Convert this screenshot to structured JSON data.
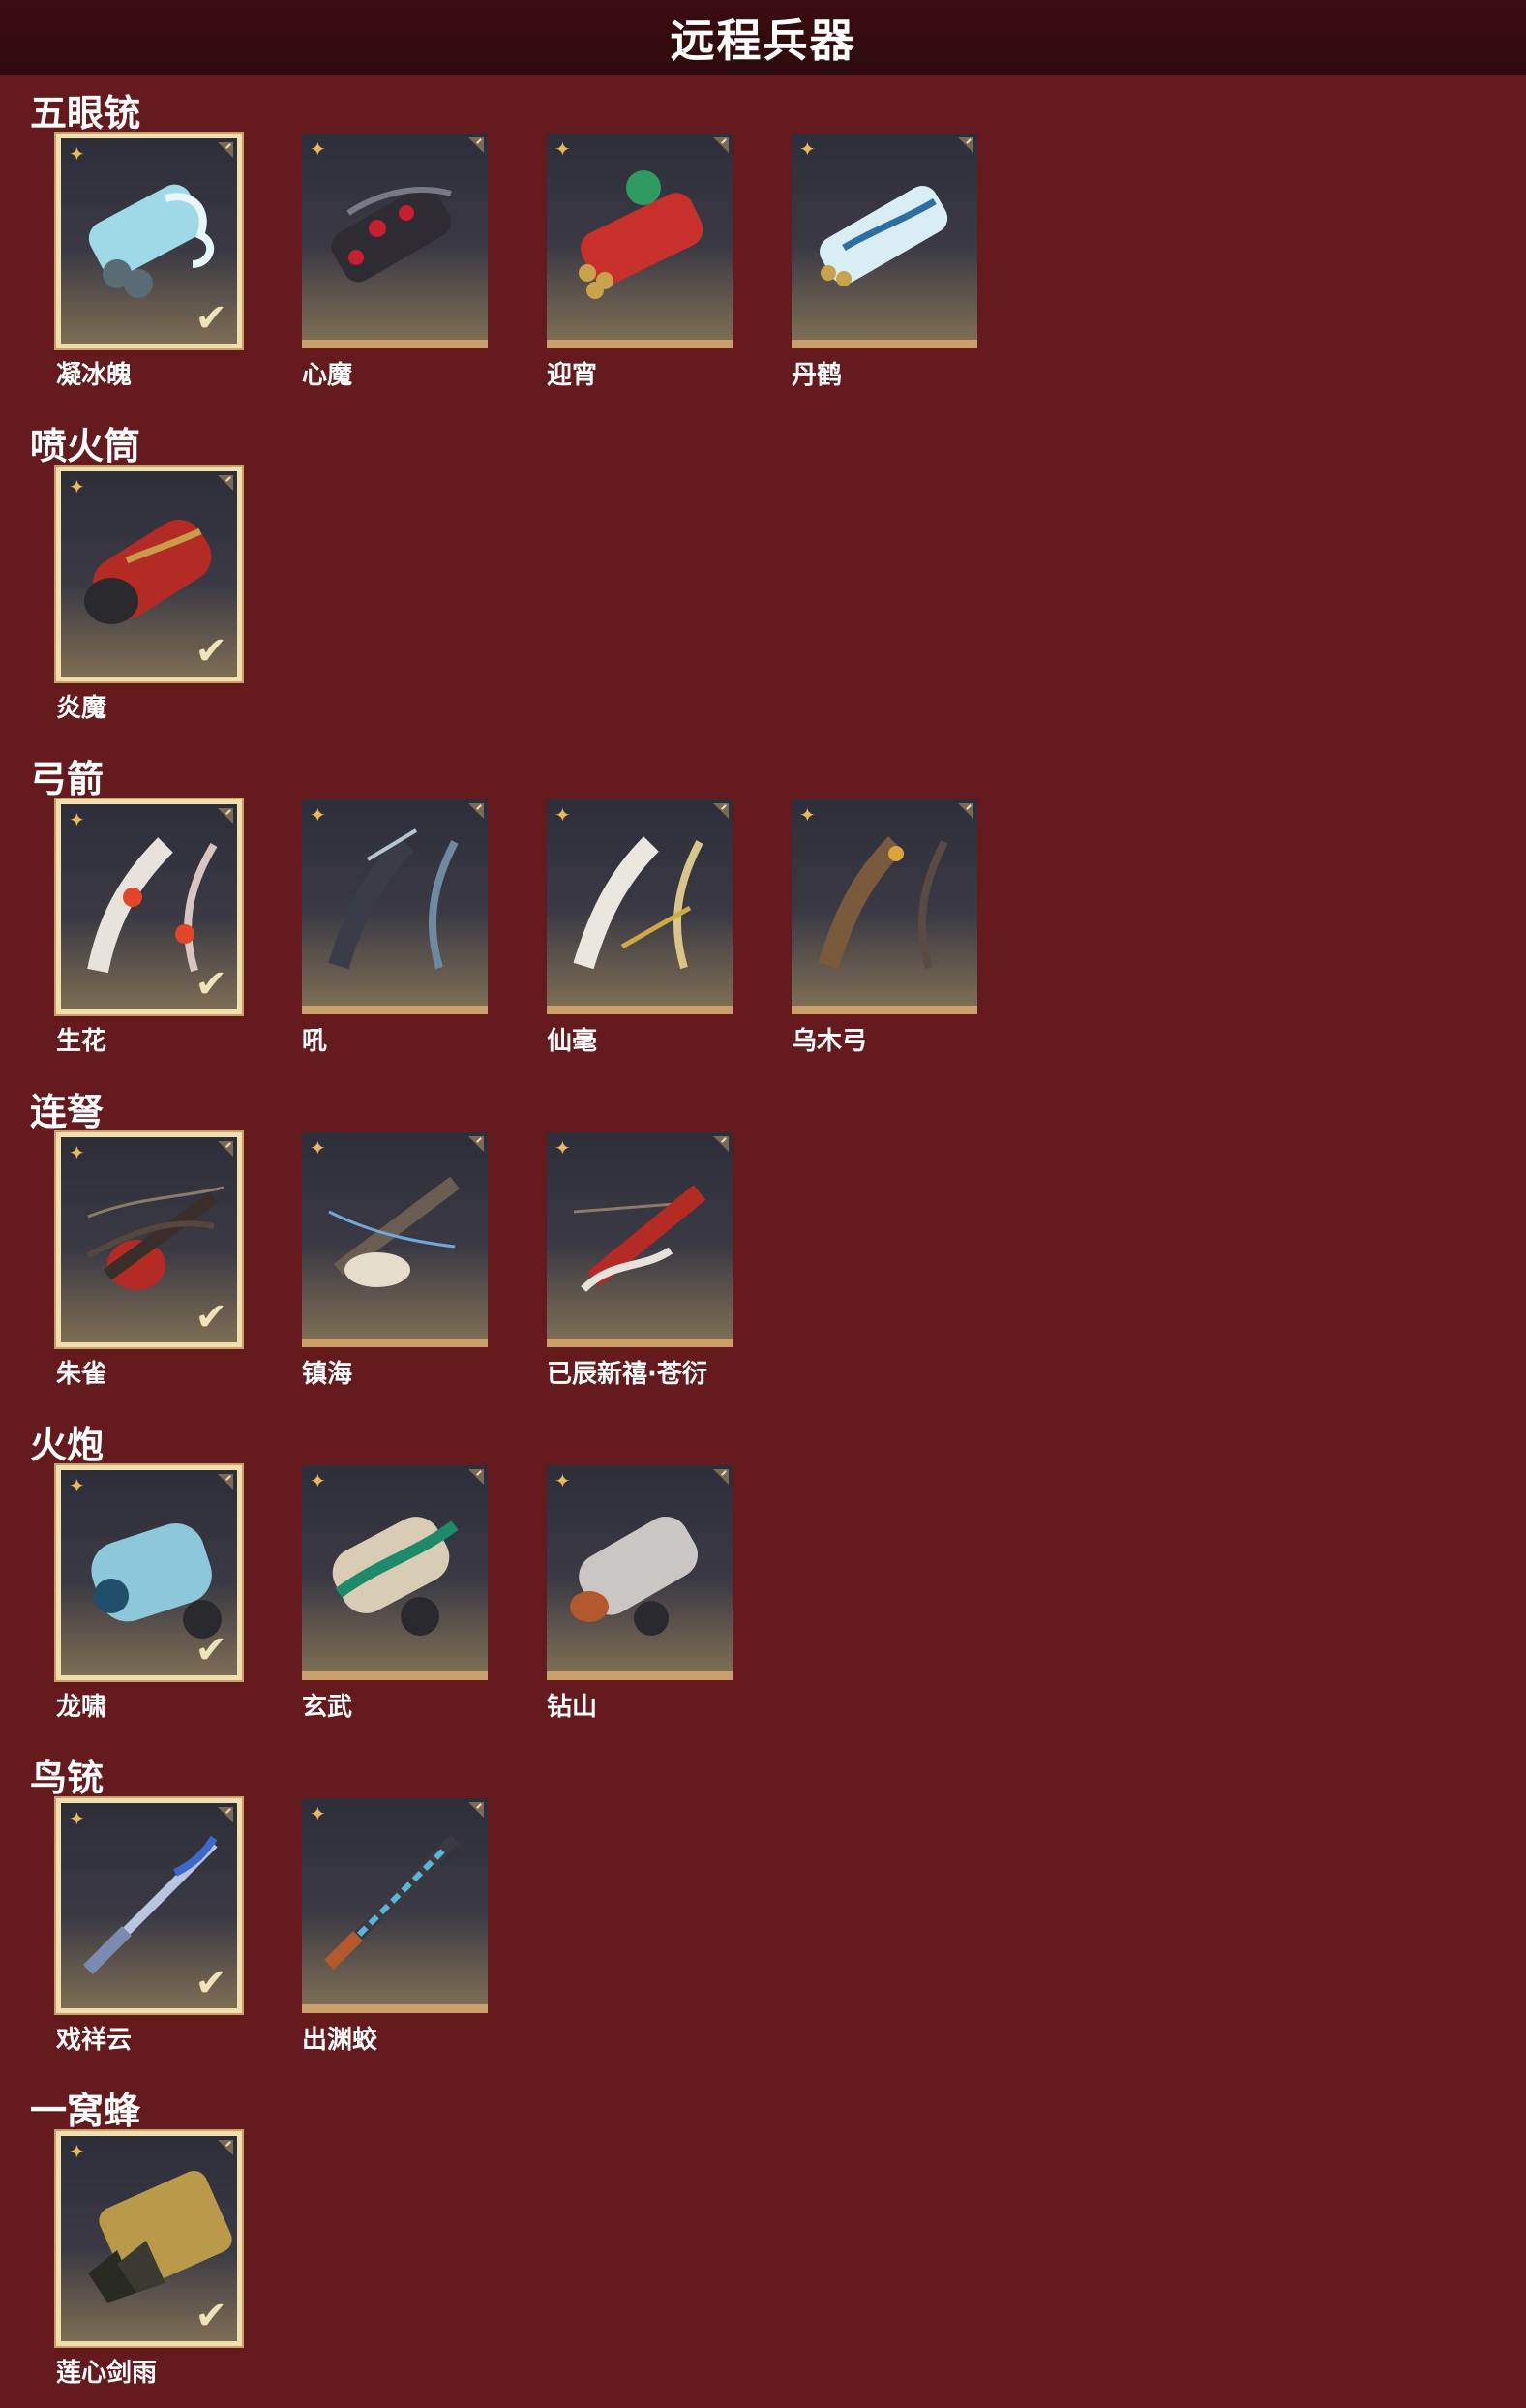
{
  "header": {
    "title": "远程兵器"
  },
  "colors": {
    "background": "#651a1e",
    "header": "#2e0a0c",
    "card_frame_gold": "#c9a06c",
    "selected_border": "#f3dfae",
    "icon_gold": "#e8b85c"
  },
  "icons": {
    "rarity": "four-point-star-icon",
    "equipped": "checkmark-icon",
    "corner": "corner-tab-icon"
  },
  "symbols": {
    "star": "✦",
    "check": "✔"
  },
  "sections": [
    {
      "title": "五眼铳",
      "items": [
        {
          "name": "凝冰魄",
          "selected": true
        },
        {
          "name": "心魔",
          "selected": false
        },
        {
          "name": "迎宵",
          "selected": false
        },
        {
          "name": "丹鹤",
          "selected": false
        }
      ]
    },
    {
      "title": "喷火筒",
      "items": [
        {
          "name": "炎魔",
          "selected": true
        }
      ]
    },
    {
      "title": "弓箭",
      "items": [
        {
          "name": "生花",
          "selected": true
        },
        {
          "name": "吼",
          "selected": false
        },
        {
          "name": "仙毫",
          "selected": false
        },
        {
          "name": "乌木弓",
          "selected": false
        }
      ]
    },
    {
      "title": "连弩",
      "items": [
        {
          "name": "朱雀",
          "selected": true
        },
        {
          "name": "镇海",
          "selected": false
        },
        {
          "name": "已辰新禧·苍衍",
          "selected": false
        }
      ]
    },
    {
      "title": "火炮",
      "items": [
        {
          "name": "龙啸",
          "selected": true
        },
        {
          "name": "玄武",
          "selected": false
        },
        {
          "name": "钻山",
          "selected": false
        }
      ]
    },
    {
      "title": "鸟铳",
      "items": [
        {
          "name": "戏祥云",
          "selected": true
        },
        {
          "name": "出渊蛟",
          "selected": false
        }
      ]
    },
    {
      "title": "一窝蜂",
      "items": [
        {
          "name": "莲心剑雨",
          "selected": true
        }
      ]
    }
  ]
}
